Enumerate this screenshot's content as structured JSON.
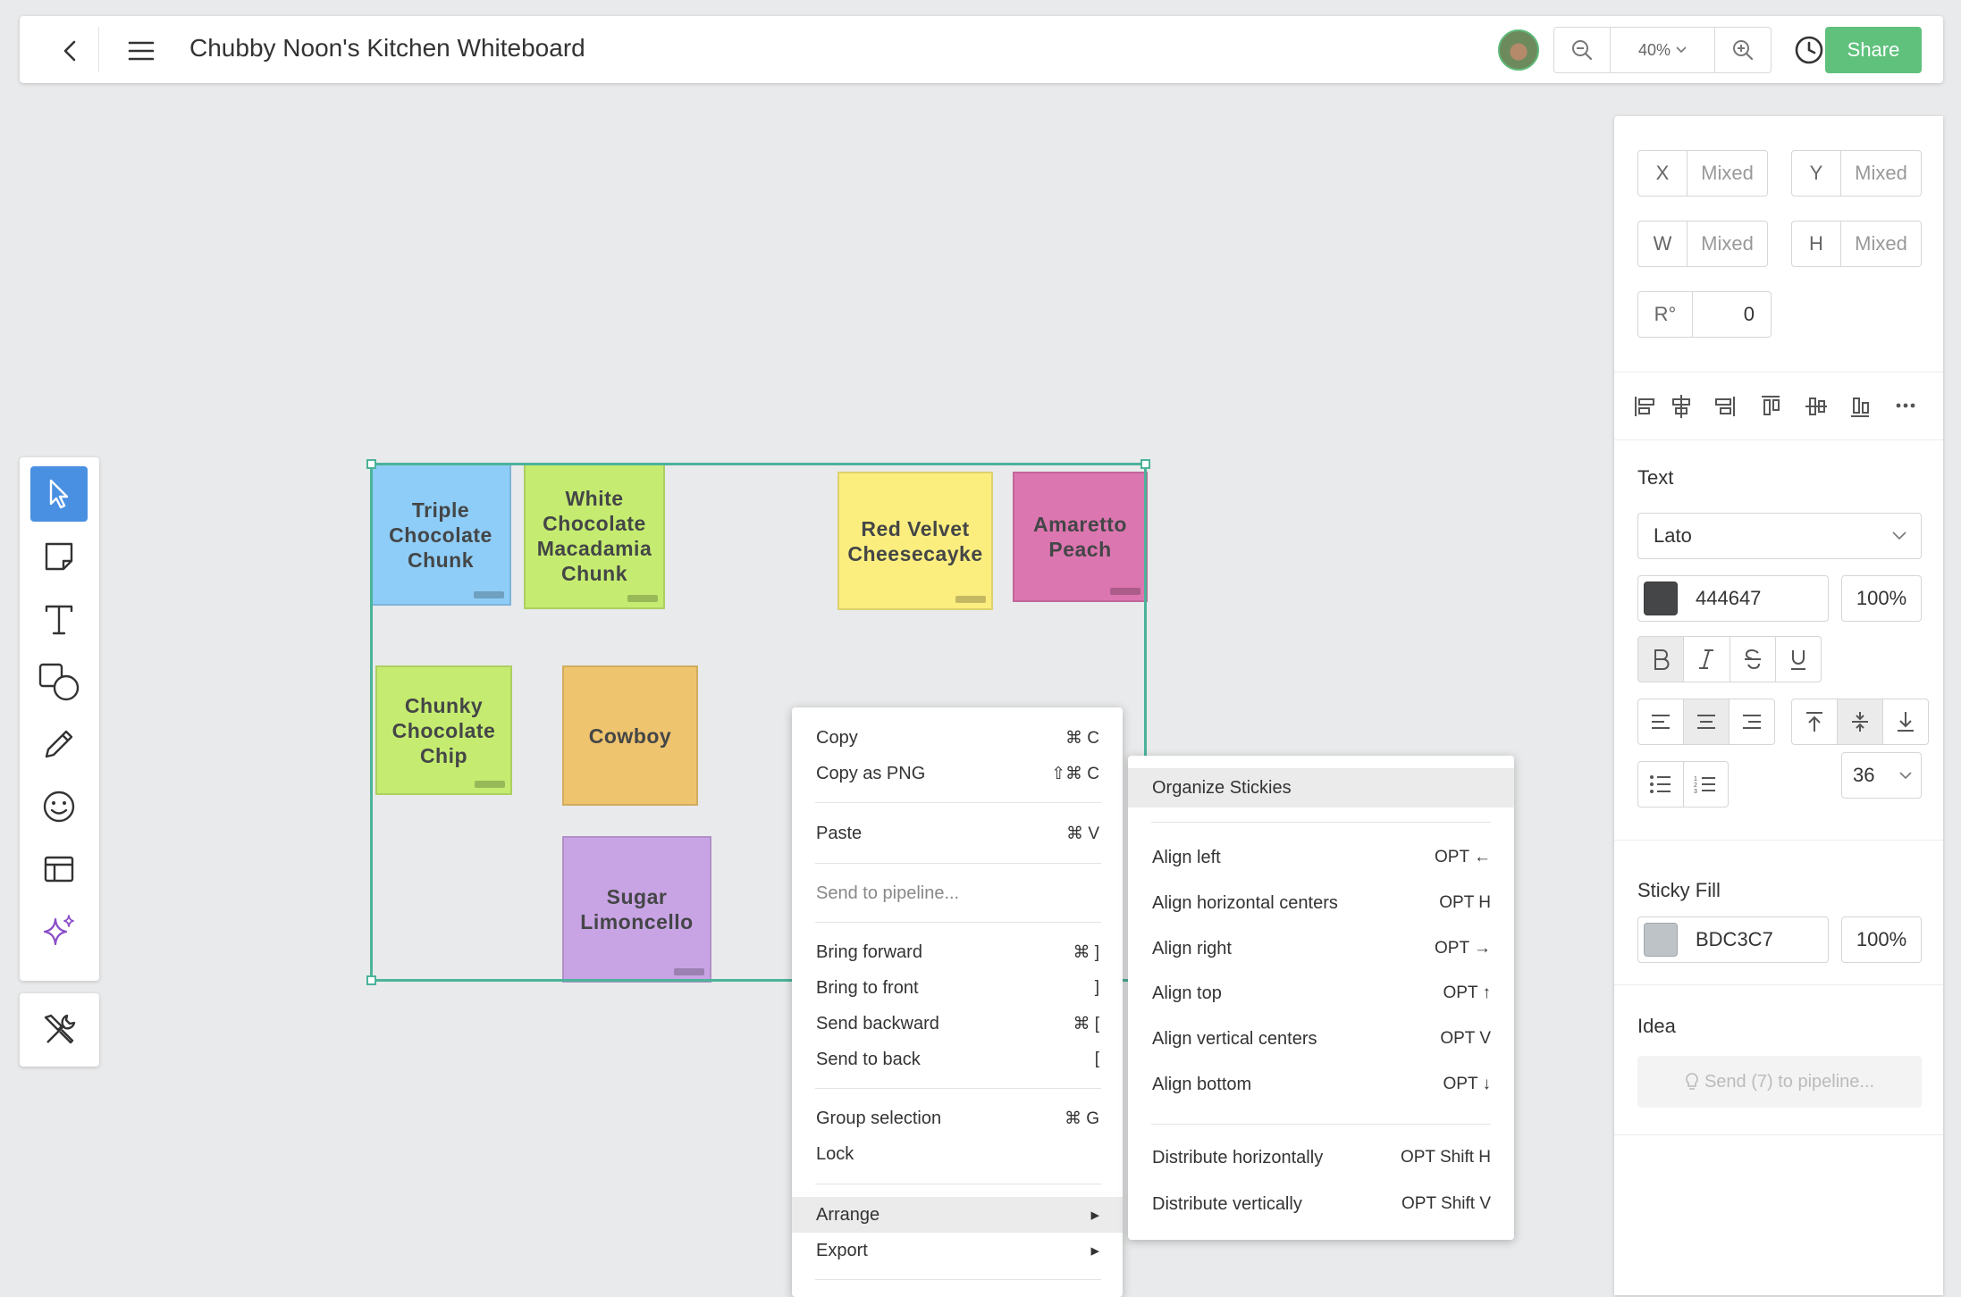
{
  "header": {
    "title": "Chubby Noon's Kitchen Whiteboard",
    "zoom_level": "40%",
    "share_label": "Share",
    "icons": [
      "back-arrow-icon",
      "hamburger-menu-icon",
      "zoom-out-icon",
      "zoom-in-icon",
      "history-clock-icon"
    ]
  },
  "toolbar": {
    "tools": [
      "select",
      "sticky-note",
      "text",
      "shapes",
      "pen",
      "emoji",
      "template",
      "ai-sparkle"
    ],
    "active": "select",
    "extra": "tools-settings"
  },
  "stickies": [
    {
      "label": "Triple Chocolate Chunk",
      "color": "#8ecdf7"
    },
    {
      "label": "White Chocolate Macadamia Chunk",
      "color": "#c5ec70"
    },
    {
      "label": "Red Velvet Cheesecayke",
      "color": "#fcee7e"
    },
    {
      "label": "Amaretto Peach",
      "color": "#dc76b0"
    },
    {
      "label": "Chunky Chocolate Chip",
      "color": "#c5ec70"
    },
    {
      "label": "Cowboy",
      "color": "#eec46e"
    },
    {
      "label": "Sugar Limoncello",
      "color": "#c9a4e4"
    }
  ],
  "context_menu": {
    "items": [
      {
        "label": "Copy",
        "shortcut": "⌘ C"
      },
      {
        "label": "Copy as PNG",
        "shortcut": "⇧⌘ C"
      },
      {
        "label": "Paste",
        "shortcut": "⌘ V"
      },
      {
        "label": "Send to pipeline...",
        "shortcut": ""
      },
      {
        "label": "Bring forward",
        "shortcut": "⌘ ]"
      },
      {
        "label": "Bring to front",
        "shortcut": "]"
      },
      {
        "label": "Send backward",
        "shortcut": "⌘ ["
      },
      {
        "label": "Send to back",
        "shortcut": "["
      },
      {
        "label": "Group selection",
        "shortcut": "⌘ G"
      },
      {
        "label": "Lock",
        "shortcut": ""
      },
      {
        "label": "Arrange",
        "shortcut": "▸"
      },
      {
        "label": "Export",
        "shortcut": "▸"
      }
    ]
  },
  "submenu": {
    "items": [
      {
        "label": "Organize Stickies",
        "shortcut": ""
      },
      {
        "label": "Align left",
        "shortcut": "OPT ←"
      },
      {
        "label": "Align horizontal centers",
        "shortcut": "OPT H"
      },
      {
        "label": "Align right",
        "shortcut": "OPT →"
      },
      {
        "label": "Align top",
        "shortcut": "OPT ↑"
      },
      {
        "label": "Align vertical centers",
        "shortcut": "OPT V"
      },
      {
        "label": "Align bottom",
        "shortcut": "OPT ↓"
      },
      {
        "label": "Distribute horizontally",
        "shortcut": "OPT Shift H"
      },
      {
        "label": "Distribute vertically",
        "shortcut": "OPT Shift V"
      }
    ]
  },
  "panel": {
    "x": {
      "key": "X",
      "value": "Mixed"
    },
    "y": {
      "key": "Y",
      "value": "Mixed"
    },
    "w": {
      "key": "W",
      "value": "Mixed"
    },
    "h": {
      "key": "H",
      "value": "Mixed"
    },
    "r": {
      "key": "R°",
      "value": "0"
    },
    "text_title": "Text",
    "font": "Lato",
    "text_color": "444647",
    "text_color_hex": "#444647",
    "text_opacity": "100%",
    "font_size": "36",
    "fill_title": "Sticky Fill",
    "fill_color": "BDC3C7",
    "fill_color_hex": "#BDC3C7",
    "fill_opacity": "100%",
    "idea_title": "Idea",
    "pipeline_button": "Send (7) to pipeline..."
  }
}
